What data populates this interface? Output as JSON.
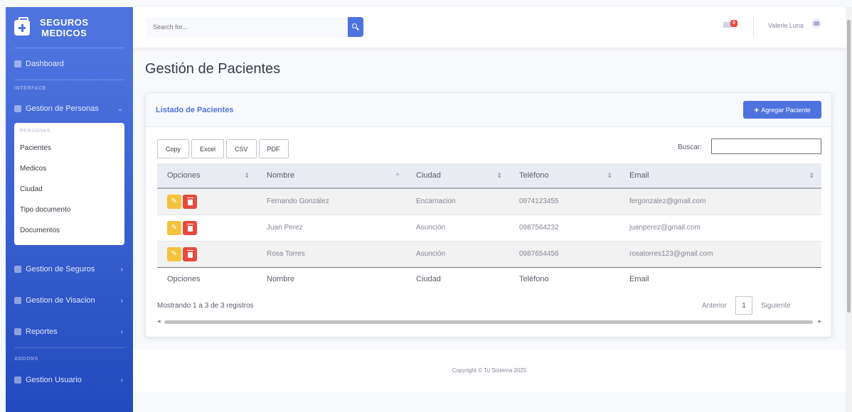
{
  "brand": {
    "line1": "SEGUROS",
    "line2": "MEDICOS",
    "icon": "medkit-icon"
  },
  "sidebar": {
    "dashboard": "Dashboard",
    "interface_heading": "INTERFACE",
    "personas_menu": "Gestion de Personas",
    "collapse_heading": "PERSONAS",
    "collapse_items": [
      "Pacientes",
      "Medicos",
      "Ciudad",
      "Tipo documento",
      "Documentos"
    ],
    "seguros": "Gestion de Seguros",
    "visacion": "Gestion de Visacion",
    "reportes": "Reportes",
    "addons_heading": "ADDONS",
    "usuario": "Gestion Usuario"
  },
  "topbar": {
    "search_placeholder": "Search for...",
    "mail_badge": "0",
    "user_name": "Valerie Luna"
  },
  "page": {
    "title": "Gestión de Pacientes"
  },
  "card": {
    "title": "Listado de Pacientes",
    "add_button": "Agregar Paciente",
    "export_buttons": [
      "Copy",
      "Excel",
      "CSV",
      "PDF"
    ],
    "search_label": "Buscar:",
    "columns": [
      "Opciones",
      "Nombre",
      "Ciudad",
      "Teléfono",
      "Email"
    ],
    "rows": [
      {
        "nombre": "Fernando González",
        "ciudad": "Encarnacion",
        "telefono": "0974123455",
        "email": "fergonzalez@gmail.com"
      },
      {
        "nombre": "Juan Perez",
        "ciudad": "Asunción",
        "telefono": "0987564232",
        "email": "juanperez@gmail.com"
      },
      {
        "nombre": "Rosa Torres",
        "ciudad": "Asunción",
        "telefono": "0987654456",
        "email": "rosatorres123@gmail.com"
      }
    ],
    "info": "Mostrando 1 a 3 de 3 registros",
    "pager": {
      "prev": "Anterior",
      "current": "1",
      "next": "Siguiente"
    }
  },
  "footer": {
    "text": "Copyright © Tu Sistema 2025"
  },
  "colors": {
    "primary": "#4e73df",
    "warning": "#f6c23e",
    "danger": "#e74a3b"
  }
}
